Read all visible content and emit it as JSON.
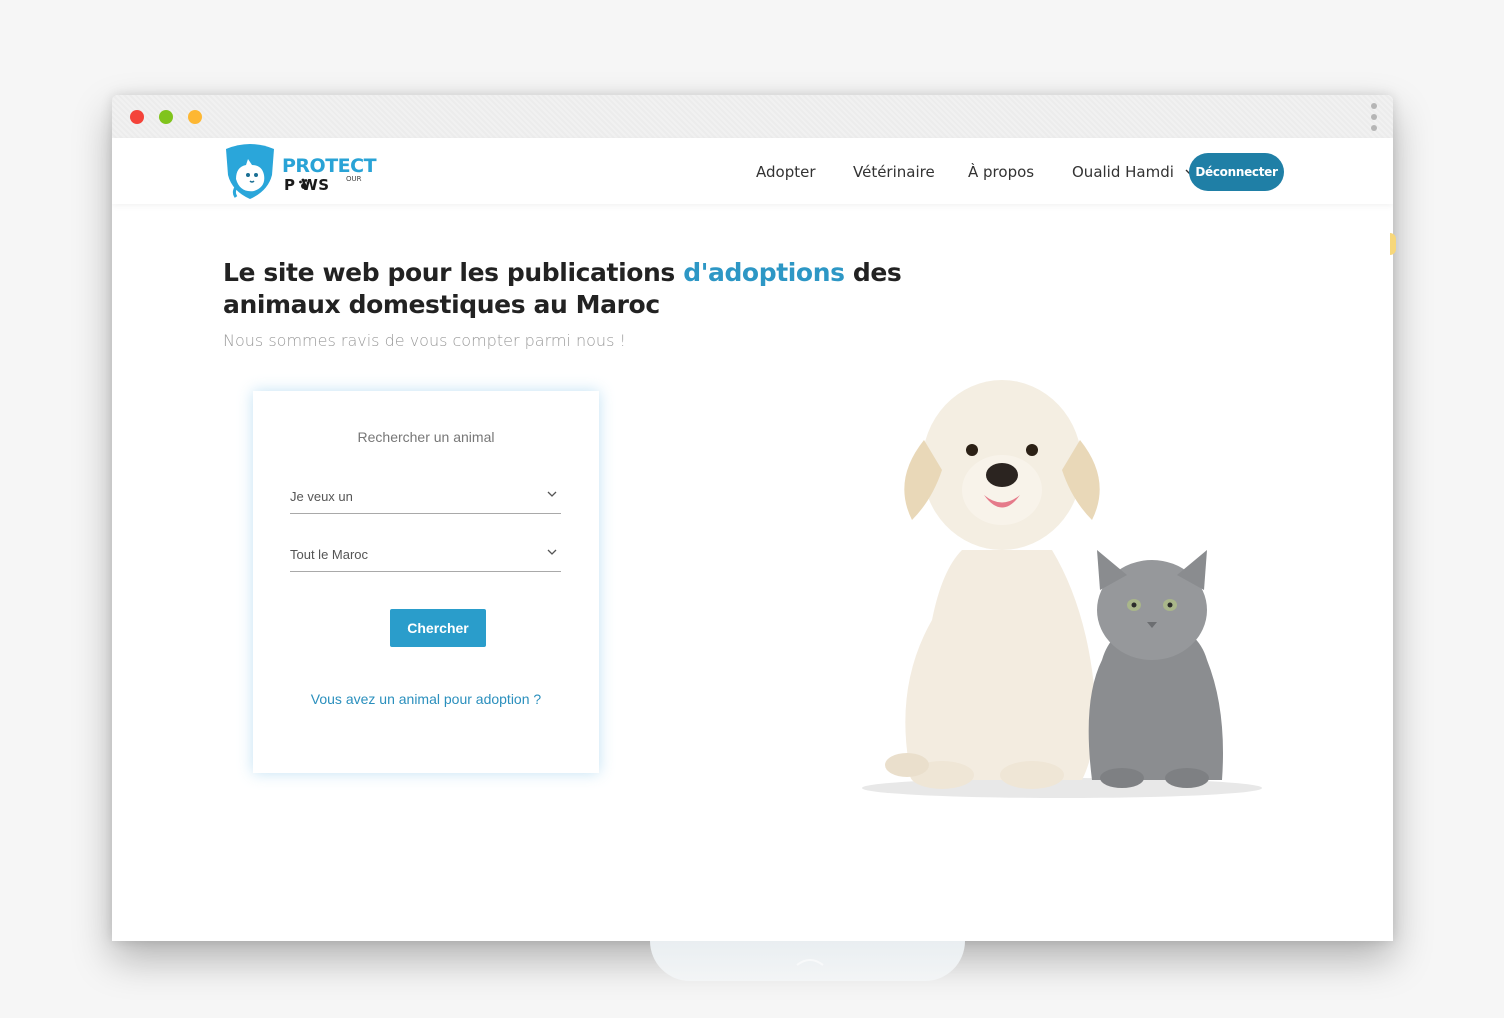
{
  "window": {
    "controls": [
      "close",
      "minimize",
      "zoom"
    ],
    "menu_icon": "kebab-menu-icon"
  },
  "navbar": {
    "logo": {
      "line1": "PROTECT",
      "line2": "P  WS",
      "line3": "OUR"
    },
    "links": {
      "adopter": "Adopter",
      "veterinaire": "Vétérinaire",
      "a_propos": "À propos",
      "user": "Oualid Hamdi"
    },
    "logout_label": "Déconnecter"
  },
  "hero": {
    "title_part1": "Le site web pour les publications ",
    "title_accent": "d'adoptions",
    "title_part2": " des animaux domestiques au Maroc",
    "subtitle": "Nous sommes ravis de vous compter parmi nous !"
  },
  "search_card": {
    "title": "Rechercher un animal",
    "animal_select": "Je veux un",
    "region_select": "Tout le Maroc",
    "search_button": "Chercher",
    "adoption_link": "Vous avez un animal pour adoption ?"
  },
  "colors": {
    "accent": "#2d97c5",
    "button": "#2a9dcb",
    "logout": "#1f7fa6"
  }
}
